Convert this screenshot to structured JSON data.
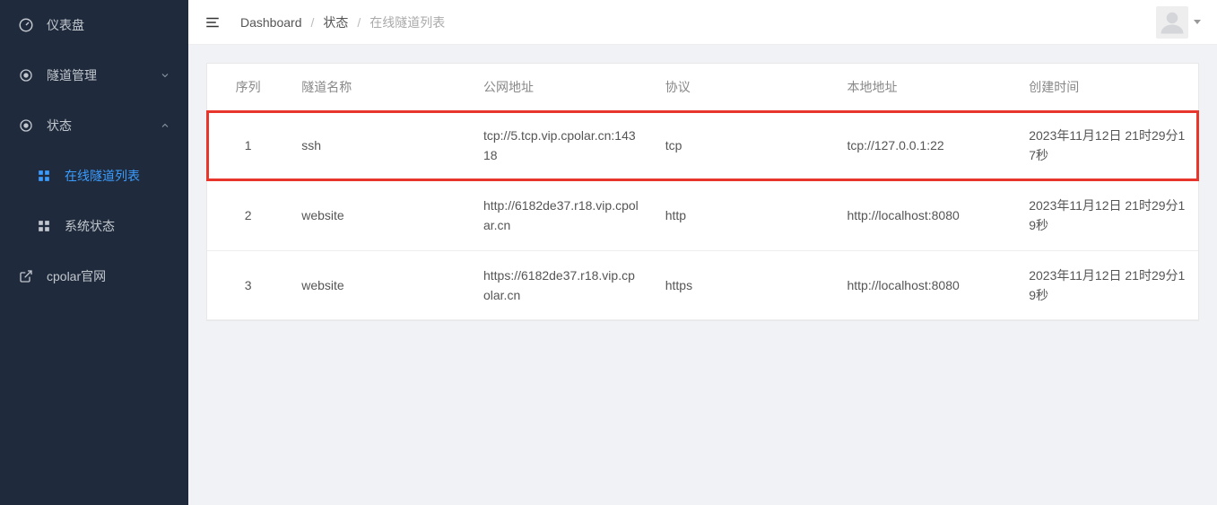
{
  "sidebar": {
    "items": [
      {
        "label": "仪表盘",
        "icon": "dashboard"
      },
      {
        "label": "隧道管理",
        "icon": "circle",
        "chevron": "down"
      },
      {
        "label": "状态",
        "icon": "circle",
        "chevron": "up"
      },
      {
        "label": "在线隧道列表",
        "icon": "grid",
        "sub": true,
        "active": true
      },
      {
        "label": "系统状态",
        "icon": "grid",
        "sub": true
      },
      {
        "label": "cpolar官网",
        "icon": "external"
      }
    ]
  },
  "breadcrumb": {
    "a": "Dashboard",
    "b": "状态",
    "c": "在线隧道列表"
  },
  "table": {
    "headers": {
      "idx": "序列",
      "name": "隧道名称",
      "pub": "公网地址",
      "proto": "协议",
      "local": "本地地址",
      "time": "创建时间"
    },
    "rows": [
      {
        "idx": "1",
        "name": "ssh",
        "pub": "tcp://5.tcp.vip.cpolar.cn:14318",
        "proto": "tcp",
        "local": "tcp://127.0.0.1:22",
        "time": "2023年11月12日 21时29分17秒",
        "highlight": true
      },
      {
        "idx": "2",
        "name": "website",
        "pub": "http://6182de37.r18.vip.cpolar.cn",
        "proto": "http",
        "local": "http://localhost:8080",
        "time": "2023年11月12日 21时29分19秒"
      },
      {
        "idx": "3",
        "name": "website",
        "pub": "https://6182de37.r18.vip.cpolar.cn",
        "proto": "https",
        "local": "http://localhost:8080",
        "time": "2023年11月12日 21时29分19秒"
      }
    ]
  }
}
